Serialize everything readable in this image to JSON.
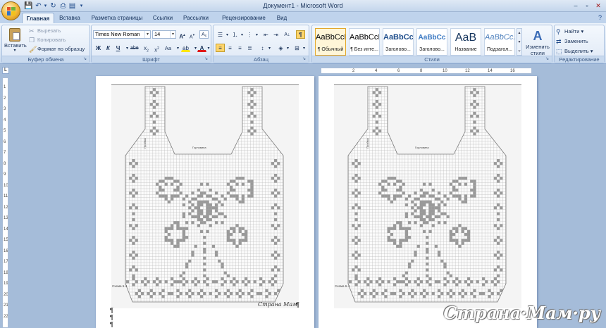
{
  "window": {
    "title": "Документ1 - Microsoft Word"
  },
  "tabs": [
    "Главная",
    "Вставка",
    "Разметка страницы",
    "Ссылки",
    "Рассылки",
    "Рецензирование",
    "Вид"
  ],
  "clipboard": {
    "paste": "Вставить",
    "cut": "Вырезать",
    "copy": "Копировать",
    "format_painter": "Формат по образцу",
    "label": "Буфер обмена"
  },
  "font": {
    "name": "Times New Roman",
    "size": "14",
    "label": "Шрифт"
  },
  "paragraph": {
    "label": "Абзац"
  },
  "styles": {
    "label": "Стили",
    "items": [
      {
        "preview": "AaBbCcI",
        "name": "¶ Обычный"
      },
      {
        "preview": "AaBbCcI",
        "name": "¶ Без инте..."
      },
      {
        "preview": "AaBbCc",
        "name": "Заголово..."
      },
      {
        "preview": "AaBbCc",
        "name": "Заголово..."
      },
      {
        "preview": "AaB",
        "name": "Название"
      },
      {
        "preview": "AaBbCc.",
        "name": "Подзагол..."
      }
    ],
    "change": "Изменить стили"
  },
  "editing": {
    "label": "Редактирование",
    "find": "Найти",
    "replace": "Заменить",
    "select": "Выделить"
  },
  "ruler": {
    "h_ticks": [
      "2",
      "4",
      "6",
      "8",
      "10",
      "12",
      "14",
      "16"
    ],
    "v_ticks": [
      "1",
      "2",
      "3",
      "4",
      "5",
      "6",
      "7",
      "8",
      "9",
      "10",
      "11",
      "12",
      "13",
      "14",
      "15",
      "16",
      "17",
      "18",
      "19",
      "20",
      "21",
      "22"
    ]
  },
  "document": {
    "pages": [
      {
        "scheme_label": "Схема 6-4",
        "top_label": "Горловина",
        "side_label": "Пройма",
        "stamp": "Страна Мам"
      },
      {
        "scheme_label": "Схема 6-4",
        "top_label": "Горловина",
        "side_label": "Пройма",
        "stamp": ""
      }
    ]
  },
  "watermark": "Страна·Мам·ру",
  "colors": {
    "ribbon_bg": "#dde8f6",
    "workspace": "#a5bcd9",
    "selected": "#ffd56b"
  }
}
